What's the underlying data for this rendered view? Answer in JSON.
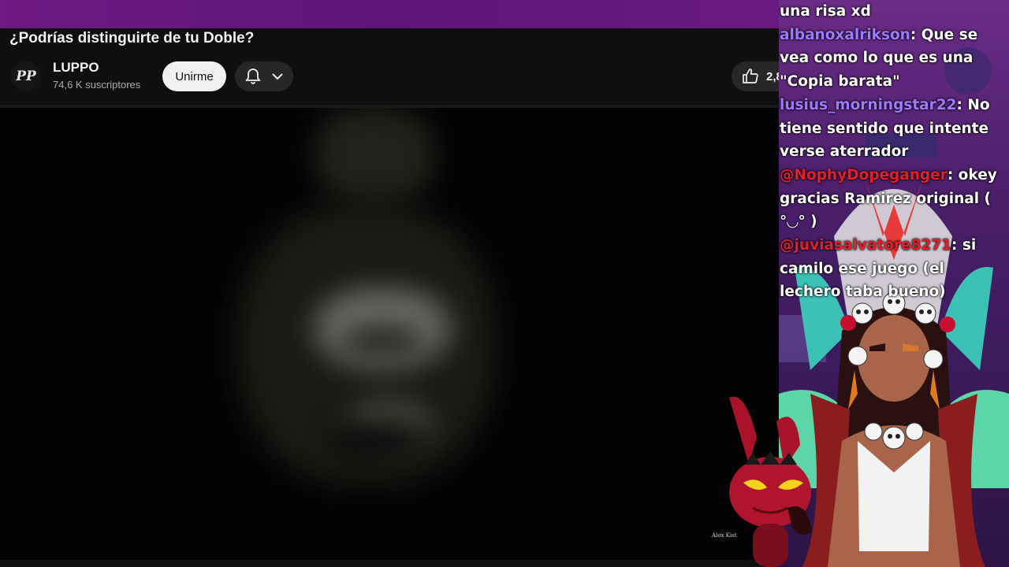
{
  "video": {
    "title": "¿Podrías distinguirte de tu Doble?",
    "channel_name": "LUPPO",
    "avatar_initials": "PP",
    "subscribers": "74,6 K suscriptores",
    "join_label": "Unirme",
    "like_count": "2,8"
  },
  "chat": {
    "messages": [
      {
        "user": "",
        "user_color": "#ffffff",
        "text": "una risa xd"
      },
      {
        "user": "albanoxalrikson",
        "user_color": "#9b7bff",
        "text": ": Que se vea como lo que es una \"Copia barata\""
      },
      {
        "user": "lusius_morningstar22",
        "user_color": "#9b7bff",
        "text": ": No tiene sentido que intente verse aterrador"
      },
      {
        "user": "@NophyDopeganger",
        "user_color": "#e0202a",
        "text": ": okey gracias Ramirez original ( °◡° )"
      },
      {
        "user": "@juviasalvatore8271",
        "user_color": "#e0202a",
        "text": ": si camilo ese juego (el lechero taba bueno)"
      }
    ]
  },
  "overlay": {
    "watermark": "Alox Kist"
  },
  "icons": {
    "bell": "bell-icon",
    "chevron": "chevron-down-icon",
    "like": "thumbs-up-icon"
  }
}
